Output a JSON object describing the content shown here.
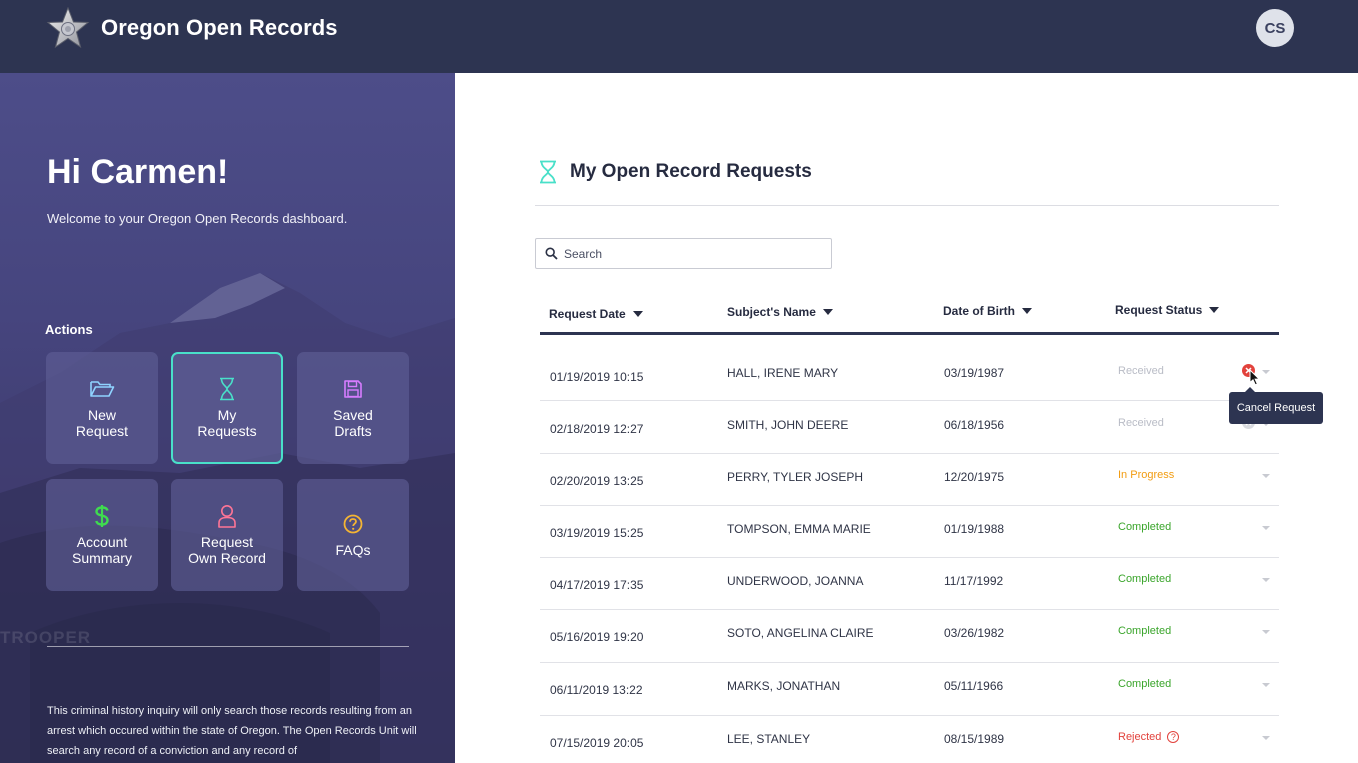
{
  "header": {
    "app_title": "Oregon Open Records",
    "avatar_initials": "CS",
    "logo_icon": "star-badge-icon"
  },
  "sidebar": {
    "greeting": "Hi Carmen!",
    "welcome": "Welcome to your Oregon Open Records dashboard.",
    "actions_label": "Actions",
    "tiles": [
      {
        "label": "New\nRequest",
        "icon": "folder-open-icon",
        "color": "#8fd3ff",
        "active": false
      },
      {
        "label": "My\nRequests",
        "icon": "hourglass-icon",
        "color": "#49e0c9",
        "active": true
      },
      {
        "label": "Saved\nDrafts",
        "icon": "floppy-disk-icon",
        "color": "#d77cff",
        "active": false
      },
      {
        "label": "Account\nSummary",
        "icon": "dollar-icon",
        "color": "#3fdb4f",
        "active": false
      },
      {
        "label": "Request\nOwn Record",
        "icon": "person-icon",
        "color": "#ff7596",
        "active": false
      },
      {
        "label": "FAQs",
        "icon": "question-circle-icon",
        "color": "#f5b533",
        "active": false
      }
    ],
    "disclaimer": "This criminal history inquiry will only search those records resulting from an arrest which occured within the state of Oregon. The Open Records Unit will search any record of a conviction and any record of",
    "background_text": "TROOPER"
  },
  "main": {
    "title": "My Open Record Requests",
    "title_icon": "hourglass-icon",
    "search": {
      "placeholder": "Search",
      "value": ""
    },
    "columns": [
      "Request Date",
      "Subject's Name",
      "Date of Birth",
      "Request Status"
    ],
    "rows": [
      {
        "date": "01/19/2019 10:15",
        "name": "HALL, IRENE MARY",
        "dob": "03/19/1987",
        "status": "Received",
        "status_color": "#b9bcc6",
        "cancel": "active"
      },
      {
        "date": "02/18/2019 12:27",
        "name": "SMITH, JOHN DEERE",
        "dob": "06/18/1956",
        "status": "Received",
        "status_color": "#b9bcc6",
        "cancel": "inactive"
      },
      {
        "date": "02/20/2019 13:25",
        "name": "PERRY, TYLER JOSEPH",
        "dob": "12/20/1975",
        "status": "In Progress",
        "status_color": "#f29c11"
      },
      {
        "date": "03/19/2019 15:25",
        "name": "TOMPSON, EMMA MARIE",
        "dob": "01/19/1988",
        "status": "Completed",
        "status_color": "#3aa52b"
      },
      {
        "date": "04/17/2019 17:35",
        "name": "UNDERWOOD, JOANNA",
        "dob": "11/17/1992",
        "status": "Completed",
        "status_color": "#3aa52b"
      },
      {
        "date": "05/16/2019 19:20",
        "name": "SOTO, ANGELINA CLAIRE",
        "dob": "03/26/1982",
        "status": "Completed",
        "status_color": "#3aa52b"
      },
      {
        "date": "06/11/2019 13:22",
        "name": "MARKS, JONATHAN",
        "dob": "05/11/1966",
        "status": "Completed",
        "status_color": "#3aa52b"
      },
      {
        "date": "07/15/2019 20:05",
        "name": "LEE, STANLEY",
        "dob": "08/15/1989",
        "status": "Rejected",
        "status_color": "#e2423c",
        "help": true
      }
    ],
    "tooltip": "Cancel Request",
    "cancel_color": "#e2423c",
    "accent": "#49e0c9",
    "header_color": "#2d3451"
  }
}
